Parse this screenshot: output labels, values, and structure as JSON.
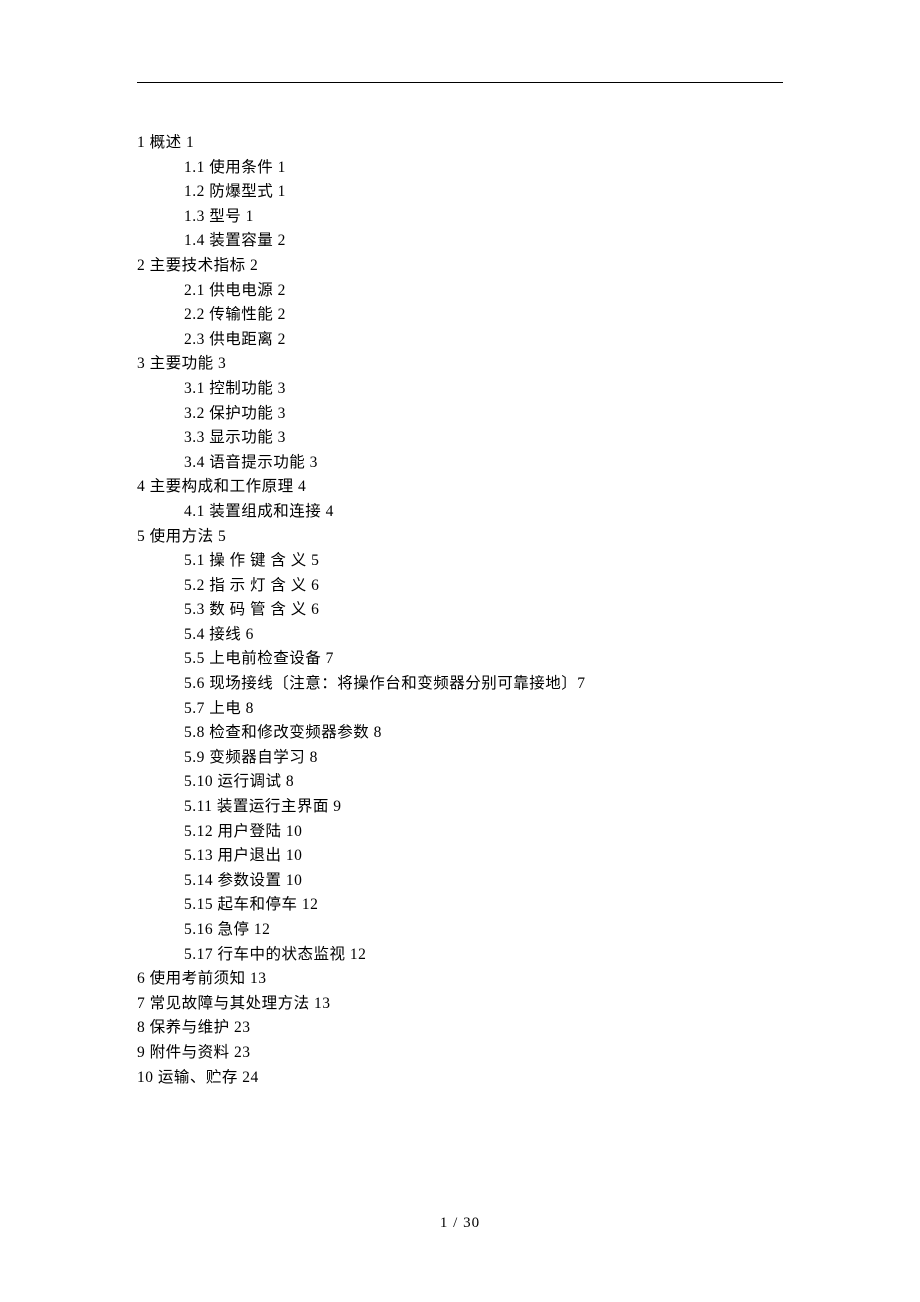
{
  "toc": [
    {
      "level": 1,
      "text": "1 概述 1"
    },
    {
      "level": 2,
      "text": "1.1 使用条件 1"
    },
    {
      "level": 2,
      "text": "1.2 防爆型式 1"
    },
    {
      "level": 2,
      "text": "1.3 型号 1"
    },
    {
      "level": 2,
      "text": "1.4 装置容量 2"
    },
    {
      "level": 1,
      "text": "2 主要技术指标 2"
    },
    {
      "level": 2,
      "text": "2.1 供电电源 2"
    },
    {
      "level": 2,
      "text": "2.2 传输性能 2"
    },
    {
      "level": 2,
      "text": "2.3 供电距离 2"
    },
    {
      "level": 1,
      "text": "3 主要功能 3"
    },
    {
      "level": 2,
      "text": "3.1 控制功能 3"
    },
    {
      "level": 2,
      "text": "3.2 保护功能 3"
    },
    {
      "level": 2,
      "text": "3.3 显示功能 3"
    },
    {
      "level": 2,
      "text": "3.4 语音提示功能 3"
    },
    {
      "level": 1,
      "text": "4 主要构成和工作原理 4"
    },
    {
      "level": 2,
      "text": "4.1 装置组成和连接 4"
    },
    {
      "level": 1,
      "text": "5 使用方法 5"
    },
    {
      "level": 2,
      "text": "5.1 操 作 键 含 义 5"
    },
    {
      "level": 2,
      "text": "5.2 指 示 灯 含 义 6"
    },
    {
      "level": 2,
      "text": "5.3 数 码 管 含 义 6"
    },
    {
      "level": 2,
      "text": "5.4 接线 6"
    },
    {
      "level": 2,
      "text": "5.5 上电前检查设备 7"
    },
    {
      "level": 2,
      "text": "5.6 现场接线〔注意：将操作台和变频器分别可靠接地〕7"
    },
    {
      "level": 2,
      "text": "5.7 上电 8"
    },
    {
      "level": 2,
      "text": "5.8 检查和修改变频器参数 8"
    },
    {
      "level": 2,
      "text": "5.9 变频器自学习 8"
    },
    {
      "level": 2,
      "text": "5.10 运行调试 8"
    },
    {
      "level": 2,
      "text": "5.11 装置运行主界面 9"
    },
    {
      "level": 2,
      "text": "5.12 用户登陆 10"
    },
    {
      "level": 2,
      "text": "5.13 用户退出 10"
    },
    {
      "level": 2,
      "text": "5.14 参数设置 10"
    },
    {
      "level": 2,
      "text": "5.15 起车和停车 12"
    },
    {
      "level": 2,
      "text": "5.16 急停 12"
    },
    {
      "level": 2,
      "text": "5.17 行车中的状态监视 12"
    },
    {
      "level": 1,
      "text": "6 使用考前须知 13"
    },
    {
      "level": 1,
      "text": "7 常见故障与其处理方法 13"
    },
    {
      "level": 1,
      "text": "8 保养与维护 23"
    },
    {
      "level": 1,
      "text": "9 附件与资料 23"
    },
    {
      "level": 1,
      "text": "10 运输、贮存 24"
    }
  ],
  "page_number": "1 / 30"
}
